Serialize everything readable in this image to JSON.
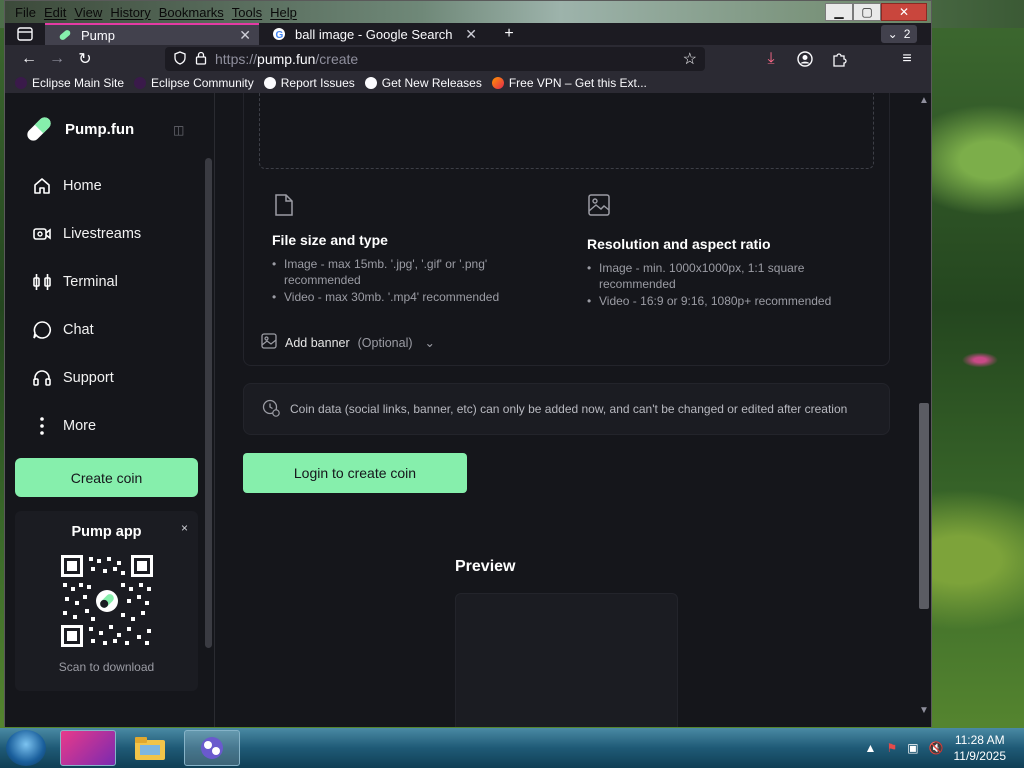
{
  "browser": {
    "menu": [
      "File",
      "Edit",
      "View",
      "History",
      "Bookmarks",
      "Tools",
      "Help"
    ],
    "tabs": [
      {
        "label": "Pump",
        "active": true
      },
      {
        "label": "ball image - Google Search",
        "active": false
      }
    ],
    "tab_count": "2",
    "url_proto": "https://",
    "url_host": "pump.fun",
    "url_path": "/create",
    "bookmarks": [
      "Eclipse Main Site",
      "Eclipse Community",
      "Report Issues",
      "Get New Releases",
      "Free VPN – Get this Ext..."
    ]
  },
  "sidebar": {
    "brand": "Pump.fun",
    "items": [
      {
        "label": "Home",
        "icon": "home-icon"
      },
      {
        "label": "Livestreams",
        "icon": "video-icon"
      },
      {
        "label": "Terminal",
        "icon": "terminal-icon"
      },
      {
        "label": "Chat",
        "icon": "chat-icon"
      },
      {
        "label": "Support",
        "icon": "headset-icon"
      },
      {
        "label": "More",
        "icon": "more-icon"
      }
    ],
    "create_label": "Create coin",
    "app_title": "Pump app",
    "app_close": "×",
    "scan_label": "Scan to download"
  },
  "main": {
    "file_title": "File size and type",
    "file_items": [
      "Image - max 15mb. '.jpg', '.gif' or '.png' recommended",
      "Video - max 30mb. '.mp4' recommended"
    ],
    "res_title": "Resolution and aspect ratio",
    "res_items": [
      "Image - min. 1000x1000px, 1:1 square recommended",
      "Video - 16:9 or 9:16, 1080p+ recommended"
    ],
    "banner_label": "Add banner",
    "banner_optional": "(Optional)",
    "info_text": "Coin data (social links, banner, etc) can only be added now, and can't be changed or edited after creation",
    "login_label": "Login to create coin",
    "preview_title": "Preview"
  },
  "taskbar": {
    "time": "11:28 AM",
    "date": "11/9/2025"
  },
  "colors": {
    "accent": "#86efac",
    "tab_highlight": "#e43ba4",
    "page_bg": "#15161b"
  }
}
